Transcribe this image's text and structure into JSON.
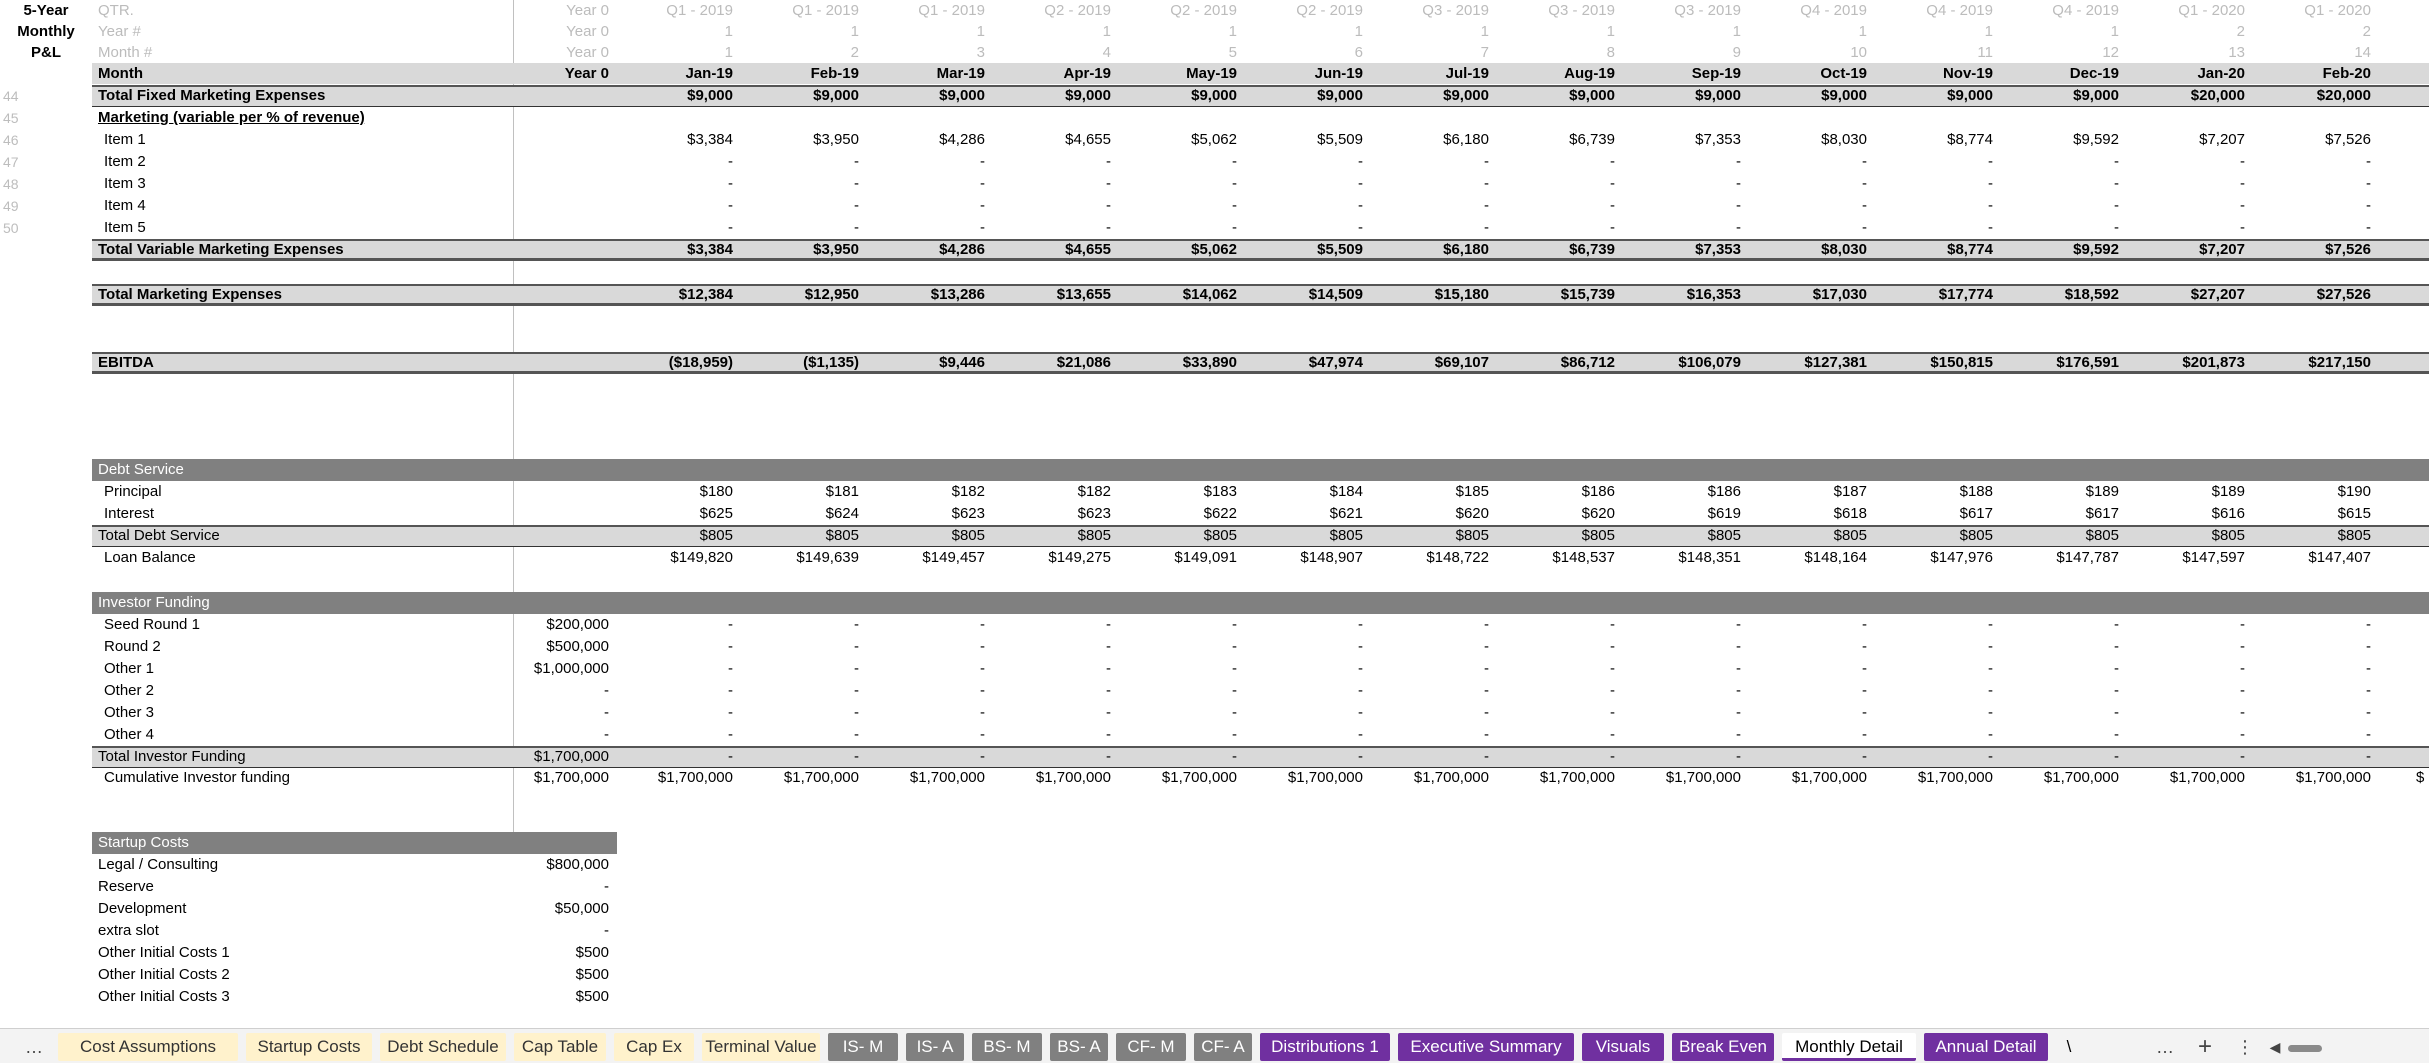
{
  "corner_title": [
    "5-Year",
    "Monthly",
    "P&L"
  ],
  "header_rows": {
    "qtr": {
      "label": "QTR.",
      "year0": "Year 0",
      "months": [
        "Q1 - 2019",
        "Q1 - 2019",
        "Q1 - 2019",
        "Q2 - 2019",
        "Q2 - 2019",
        "Q2 - 2019",
        "Q3 - 2019",
        "Q3 - 2019",
        "Q3 - 2019",
        "Q4 - 2019",
        "Q4 - 2019",
        "Q4 - 2019",
        "Q1 - 2020",
        "Q1 - 2020"
      ]
    },
    "year_num": {
      "label": "Year #",
      "year0": "Year 0",
      "months": [
        "1",
        "1",
        "1",
        "1",
        "1",
        "1",
        "1",
        "1",
        "1",
        "1",
        "1",
        "1",
        "2",
        "2"
      ]
    },
    "month_num": {
      "label": "Month #",
      "year0": "Year 0",
      "months": [
        "1",
        "2",
        "3",
        "4",
        "5",
        "6",
        "7",
        "8",
        "9",
        "10",
        "11",
        "12",
        "13",
        "14"
      ]
    },
    "month": {
      "label": "Month",
      "year0": "Year 0",
      "months": [
        "Jan-19",
        "Feb-19",
        "Mar-19",
        "Apr-19",
        "May-19",
        "Jun-19",
        "Jul-19",
        "Aug-19",
        "Sep-19",
        "Oct-19",
        "Nov-19",
        "Dec-19",
        "Jan-20",
        "Feb-20"
      ]
    }
  },
  "rows": [
    {
      "num": "44",
      "label": "Total Fixed Marketing Expenses",
      "year0": "",
      "months": [
        "$9,000",
        "$9,000",
        "$9,000",
        "$9,000",
        "$9,000",
        "$9,000",
        "$9,000",
        "$9,000",
        "$9,000",
        "$9,000",
        "$9,000",
        "$9,000",
        "$20,000",
        "$20,000"
      ]
    },
    {
      "num": "45",
      "label": "Marketing (variable per % of revenue)",
      "year0": "",
      "months": []
    },
    {
      "num": "46",
      "label": "Item 1",
      "year0": "",
      "months": [
        "$3,384",
        "$3,950",
        "$4,286",
        "$4,655",
        "$5,062",
        "$5,509",
        "$6,180",
        "$6,739",
        "$7,353",
        "$8,030",
        "$8,774",
        "$9,592",
        "$7,207",
        "$7,526"
      ]
    },
    {
      "num": "47",
      "label": "Item 2",
      "year0": "",
      "months": [
        "-",
        "-",
        "-",
        "-",
        "-",
        "-",
        "-",
        "-",
        "-",
        "-",
        "-",
        "-",
        "-",
        "-"
      ]
    },
    {
      "num": "48",
      "label": "Item 3",
      "year0": "",
      "months": [
        "-",
        "-",
        "-",
        "-",
        "-",
        "-",
        "-",
        "-",
        "-",
        "-",
        "-",
        "-",
        "-",
        "-"
      ]
    },
    {
      "num": "49",
      "label": "Item 4",
      "year0": "",
      "months": [
        "-",
        "-",
        "-",
        "-",
        "-",
        "-",
        "-",
        "-",
        "-",
        "-",
        "-",
        "-",
        "-",
        "-"
      ]
    },
    {
      "num": "50",
      "label": "Item 5",
      "year0": "",
      "months": [
        "-",
        "-",
        "-",
        "-",
        "-",
        "-",
        "-",
        "-",
        "-",
        "-",
        "-",
        "-",
        "-",
        "-"
      ]
    },
    {
      "num": "",
      "label": "Total Variable Marketing Expenses",
      "year0": "",
      "months": [
        "$3,384",
        "$3,950",
        "$4,286",
        "$4,655",
        "$5,062",
        "$5,509",
        "$6,180",
        "$6,739",
        "$7,353",
        "$8,030",
        "$8,774",
        "$9,592",
        "$7,207",
        "$7,526"
      ]
    },
    {
      "num": "",
      "label": "Total Marketing Expenses",
      "year0": "",
      "months": [
        "$12,384",
        "$12,950",
        "$13,286",
        "$13,655",
        "$14,062",
        "$14,509",
        "$15,180",
        "$15,739",
        "$16,353",
        "$17,030",
        "$17,774",
        "$18,592",
        "$27,207",
        "$27,526"
      ]
    },
    {
      "num": "",
      "label": "EBITDA",
      "year0": "",
      "months": [
        "($18,959)",
        "($1,135)",
        "$9,446",
        "$21,086",
        "$33,890",
        "$47,974",
        "$69,107",
        "$86,712",
        "$106,079",
        "$127,381",
        "$150,815",
        "$176,591",
        "$201,873",
        "$217,150"
      ]
    },
    {
      "num": "",
      "label": "Debt Service",
      "year0": "",
      "months": []
    },
    {
      "num": "",
      "label": "Principal",
      "year0": "",
      "months": [
        "$180",
        "$181",
        "$182",
        "$182",
        "$183",
        "$184",
        "$185",
        "$186",
        "$186",
        "$187",
        "$188",
        "$189",
        "$189",
        "$190"
      ]
    },
    {
      "num": "",
      "label": "Interest",
      "year0": "",
      "months": [
        "$625",
        "$624",
        "$623",
        "$623",
        "$622",
        "$621",
        "$620",
        "$620",
        "$619",
        "$618",
        "$617",
        "$617",
        "$616",
        "$615"
      ]
    },
    {
      "num": "",
      "label": "Total Debt Service",
      "year0": "",
      "months": [
        "$805",
        "$805",
        "$805",
        "$805",
        "$805",
        "$805",
        "$805",
        "$805",
        "$805",
        "$805",
        "$805",
        "$805",
        "$805",
        "$805"
      ]
    },
    {
      "num": "",
      "label": "Loan Balance",
      "year0": "",
      "months": [
        "$149,820",
        "$149,639",
        "$149,457",
        "$149,275",
        "$149,091",
        "$148,907",
        "$148,722",
        "$148,537",
        "$148,351",
        "$148,164",
        "$147,976",
        "$147,787",
        "$147,597",
        "$147,407"
      ]
    },
    {
      "num": "",
      "label": "Investor Funding",
      "year0": "",
      "months": []
    },
    {
      "num": "",
      "label": "Seed Round 1",
      "year0": "$200,000",
      "months": [
        "-",
        "-",
        "-",
        "-",
        "-",
        "-",
        "-",
        "-",
        "-",
        "-",
        "-",
        "-",
        "-",
        "-"
      ]
    },
    {
      "num": "",
      "label": "Round 2",
      "year0": "$500,000",
      "months": [
        "-",
        "-",
        "-",
        "-",
        "-",
        "-",
        "-",
        "-",
        "-",
        "-",
        "-",
        "-",
        "-",
        "-"
      ]
    },
    {
      "num": "",
      "label": "Other 1",
      "year0": "$1,000,000",
      "months": [
        "-",
        "-",
        "-",
        "-",
        "-",
        "-",
        "-",
        "-",
        "-",
        "-",
        "-",
        "-",
        "-",
        "-"
      ]
    },
    {
      "num": "",
      "label": "Other 2",
      "year0": "-",
      "months": [
        "-",
        "-",
        "-",
        "-",
        "-",
        "-",
        "-",
        "-",
        "-",
        "-",
        "-",
        "-",
        "-",
        "-"
      ]
    },
    {
      "num": "",
      "label": "Other 3",
      "year0": "-",
      "months": [
        "-",
        "-",
        "-",
        "-",
        "-",
        "-",
        "-",
        "-",
        "-",
        "-",
        "-",
        "-",
        "-",
        "-"
      ]
    },
    {
      "num": "",
      "label": "Other 4",
      "year0": "-",
      "months": [
        "-",
        "-",
        "-",
        "-",
        "-",
        "-",
        "-",
        "-",
        "-",
        "-",
        "-",
        "-",
        "-",
        "-"
      ]
    },
    {
      "num": "",
      "label": "Total Investor Funding",
      "year0": "$1,700,000",
      "months": [
        "-",
        "-",
        "-",
        "-",
        "-",
        "-",
        "-",
        "-",
        "-",
        "-",
        "-",
        "-",
        "-",
        "-"
      ]
    },
    {
      "num": "",
      "label": "Cumulative Investor funding",
      "year0": "$1,700,000",
      "months": [
        "$1,700,000",
        "$1,700,000",
        "$1,700,000",
        "$1,700,000",
        "$1,700,000",
        "$1,700,000",
        "$1,700,000",
        "$1,700,000",
        "$1,700,000",
        "$1,700,000",
        "$1,700,000",
        "$1,700,000",
        "$1,700,000",
        "$1,700,000"
      ]
    },
    {
      "num": "",
      "label": "Startup Costs",
      "year0": "",
      "months": []
    },
    {
      "num": "",
      "label": "Legal / Consulting",
      "year0": "$800,000",
      "months": []
    },
    {
      "num": "",
      "label": "Reserve",
      "year0": "-",
      "months": []
    },
    {
      "num": "",
      "label": "Development",
      "year0": "$50,000",
      "months": []
    },
    {
      "num": "",
      "label": "extra slot",
      "year0": "-",
      "months": []
    },
    {
      "num": "",
      "label": "Other Initial Costs 1",
      "year0": "$500",
      "months": []
    },
    {
      "num": "",
      "label": "Other Initial Costs 2",
      "year0": "$500",
      "months": []
    },
    {
      "num": "",
      "label": "Other Initial Costs 3",
      "year0": "$500",
      "months": []
    }
  ],
  "overflow_glyph": "$",
  "sheet_tabs": {
    "more_left": "…",
    "tabs": [
      "Cost Assumptions",
      "Startup Costs",
      "Debt Schedule",
      "Cap Table",
      "Cap Ex",
      "Terminal Value",
      "IS- M",
      "IS- A",
      "BS- M",
      "BS- A",
      "CF- M",
      "CF- A",
      "Distributions 1",
      "Executive Summary",
      "Visuals",
      "Break Even",
      "Monthly Detail",
      "Annual Detail",
      "\\"
    ],
    "more_right": "…",
    "add": "+",
    "options": "⋮"
  },
  "colors": {
    "band_light": "#d9d9d9",
    "band_dark": "#808080",
    "tab_yellow": "#fff2cc",
    "tab_grey": "#808080",
    "tab_purple": "#7030a0"
  }
}
